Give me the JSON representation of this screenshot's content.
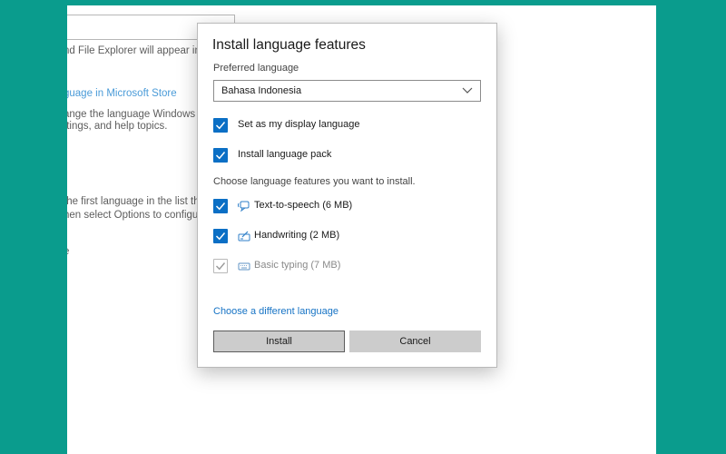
{
  "background_window": {
    "line1": "nd File Explorer will appear in th",
    "store_link": "guage in Microsoft Store",
    "line3": "ange the language Windows us",
    "line4": "ttings, and help topics.",
    "line5": "the first language in the list tha",
    "line6": "hen select Options to configure",
    "line7": "e"
  },
  "dialog": {
    "title": "Install language features",
    "preferred_label": "Preferred language",
    "selected_language": "Bahasa Indonesia",
    "options": [
      {
        "label": "Set as my display language",
        "checked": true
      },
      {
        "label": "Install language pack",
        "checked": true
      }
    ],
    "features_heading": "Choose language features you want to install.",
    "features": [
      {
        "label": "Text-to-speech (6 MB)",
        "icon": "speech-icon",
        "checked": true,
        "disabled": false
      },
      {
        "label": "Handwriting (2 MB)",
        "icon": "handwriting-icon",
        "checked": true,
        "disabled": false
      },
      {
        "label": "Basic typing (7 MB)",
        "icon": "keyboard-icon",
        "checked": true,
        "disabled": true
      }
    ],
    "different_language_link": "Choose a different language",
    "install_label": "Install",
    "cancel_label": "Cancel"
  },
  "colors": {
    "desktop": "#0a9c8d",
    "accent": "#0b6fc5",
    "link": "#1673c5"
  }
}
